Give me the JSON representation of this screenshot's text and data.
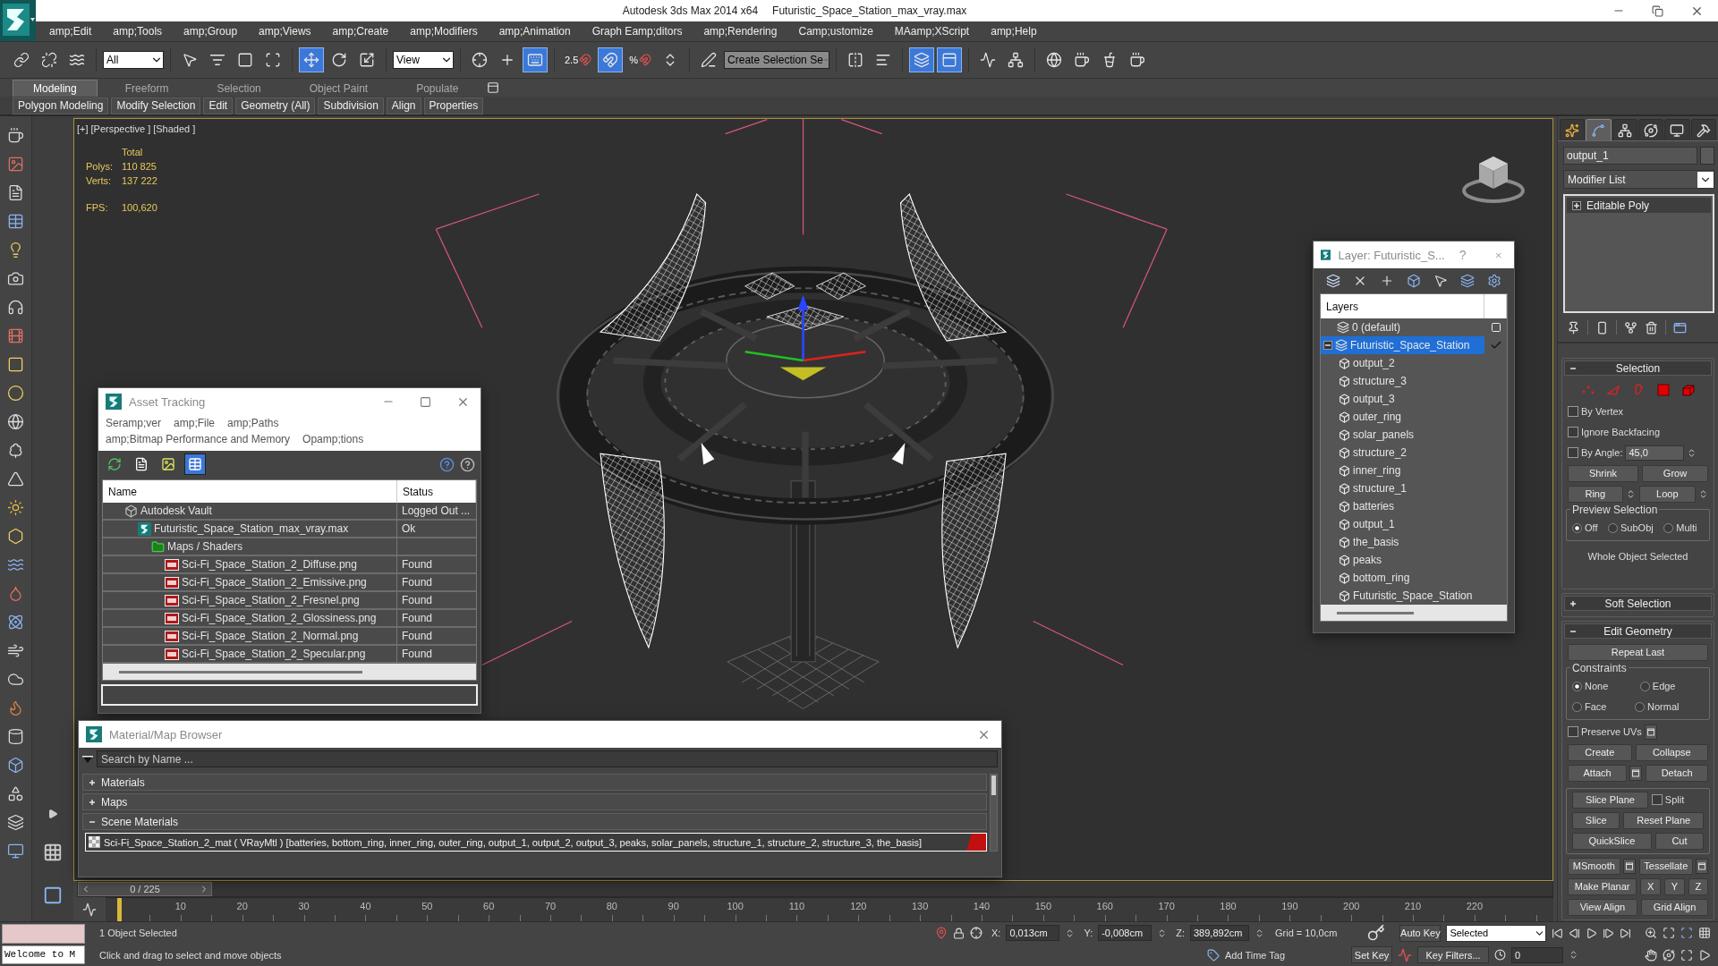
{
  "window": {
    "title": "Autodesk 3ds Max 2014 x64",
    "document": "Futuristic_Space_Station_max_vray.max"
  },
  "menu": [
    "amp;Edit",
    "amp;Tools",
    "amp;Group",
    "amp;Views",
    "amp;Create",
    "amp;Modifiers",
    "amp;Animation",
    "Graph Eamp;ditors",
    "amp;Rendering",
    "Camp;ustomize",
    "MAamp;XScript",
    "amp;Help"
  ],
  "main_toolbar": [
    {
      "kind": "button",
      "active": false
    },
    {
      "kind": "button",
      "active": false
    },
    {
      "kind": "button",
      "active": false
    },
    {
      "kind": "dropdown",
      "value": "All"
    },
    {
      "kind": "button",
      "active": false
    },
    {
      "kind": "button",
      "active": false
    },
    {
      "kind": "button",
      "active": false
    },
    {
      "kind": "button",
      "active": false
    },
    {
      "kind": "button",
      "active": true
    },
    {
      "kind": "button",
      "active": false
    },
    {
      "kind": "button",
      "active": false
    },
    {
      "kind": "dropdown",
      "value": "View"
    },
    {
      "kind": "button",
      "active": false
    },
    {
      "kind": "button",
      "active": false
    },
    {
      "kind": "button",
      "active": true
    },
    {
      "kind": "button",
      "active": false,
      "label": "2.5"
    },
    {
      "kind": "button",
      "active": true
    },
    {
      "kind": "button",
      "active": false,
      "label": "%"
    },
    {
      "kind": "button",
      "active": false
    },
    {
      "kind": "button",
      "active": false
    },
    {
      "kind": "field",
      "value": "Create Selection Se"
    },
    {
      "kind": "button",
      "active": false
    },
    {
      "kind": "button",
      "active": false
    },
    {
      "kind": "button",
      "active": true
    },
    {
      "kind": "button",
      "active": true
    },
    {
      "kind": "button",
      "active": false
    },
    {
      "kind": "button",
      "active": false
    },
    {
      "kind": "button",
      "active": false
    },
    {
      "kind": "button",
      "active": false
    },
    {
      "kind": "button",
      "active": false
    },
    {
      "kind": "button",
      "active": false
    }
  ],
  "ribbon": {
    "tabs": [
      {
        "label": "Modeling",
        "selected": true
      },
      {
        "label": "Freeform",
        "selected": false
      },
      {
        "label": "Selection",
        "selected": false
      },
      {
        "label": "Object Paint",
        "selected": false
      },
      {
        "label": "Populate",
        "selected": false
      }
    ],
    "panels": [
      "Polygon Modeling",
      "Modify Selection",
      "Edit",
      "Geometry (All)",
      "Subdivision",
      "Align",
      "Properties"
    ]
  },
  "viewport": {
    "labels": [
      "[+]",
      "[Perspective ]",
      "[Shaded ]"
    ],
    "stats": {
      "heading": "Total",
      "rows": [
        {
          "label": "Polys:",
          "value": "110 825"
        },
        {
          "label": "Verts:",
          "value": "137 222"
        }
      ],
      "fps": {
        "label": "FPS:",
        "value": "100,620"
      }
    }
  },
  "asset_tracking": {
    "title": "Asset Tracking",
    "menu_rows": [
      [
        "Seramp;ver",
        "amp;File",
        "amp;Paths"
      ],
      [
        "amp;Bitmap Performance and Memory",
        "Opamp;tions"
      ]
    ],
    "view_buttons": [
      {
        "selected": false
      },
      {
        "selected": false
      },
      {
        "selected": false
      },
      {
        "selected": true
      }
    ],
    "columns": [
      "Name",
      "Status"
    ],
    "rows": [
      {
        "kind": "vault",
        "name": "Autodesk Vault",
        "status": "Logged Out ...",
        "children": [
          {
            "kind": "scene",
            "name": "Futuristic_Space_Station_max_vray.max",
            "status": "Ok",
            "children": [
              {
                "kind": "folder",
                "name": "Maps / Shaders",
                "children": [
                  {
                    "kind": "image",
                    "name": "Sci-Fi_Space_Station_2_Diffuse.png",
                    "status": "Found"
                  },
                  {
                    "kind": "image",
                    "name": "Sci-Fi_Space_Station_2_Emissive.png",
                    "status": "Found"
                  },
                  {
                    "kind": "image",
                    "name": "Sci-Fi_Space_Station_2_Fresnel.png",
                    "status": "Found"
                  },
                  {
                    "kind": "image",
                    "name": "Sci-Fi_Space_Station_2_Glossiness.png",
                    "status": "Found"
                  },
                  {
                    "kind": "image",
                    "name": "Sci-Fi_Space_Station_2_Normal.png",
                    "status": "Found"
                  },
                  {
                    "kind": "image",
                    "name": "Sci-Fi_Space_Station_2_Specular.png",
                    "status": "Found"
                  }
                ]
              }
            ]
          }
        ]
      }
    ]
  },
  "layer_manager": {
    "title": "Layer: Futuristic_S...",
    "help": "?",
    "header": "Layers",
    "layers": [
      {
        "name": "0 (default)",
        "current": false,
        "selected": false
      },
      {
        "name": "Futuristic_Space_Station",
        "current": true,
        "selected": true,
        "expanded": true,
        "children": [
          {
            "name": "output_2",
            "selected": false
          },
          {
            "name": "structure_3",
            "selected": false
          },
          {
            "name": "output_3",
            "selected": false
          },
          {
            "name": "outer_ring",
            "selected": false
          },
          {
            "name": "solar_panels",
            "selected": false
          },
          {
            "name": "structure_2",
            "selected": false
          },
          {
            "name": "inner_ring",
            "selected": false
          },
          {
            "name": "structure_1",
            "selected": false
          },
          {
            "name": "batteries",
            "selected": false
          },
          {
            "name": "output_1",
            "selected": false
          },
          {
            "name": "the_basis",
            "selected": false
          },
          {
            "name": "peaks",
            "selected": false
          },
          {
            "name": "bottom_ring",
            "selected": false
          },
          {
            "name": "Futuristic_Space_Station",
            "selected": false
          }
        ]
      }
    ]
  },
  "material_browser": {
    "title": "Material/Map Browser",
    "search_placeholder": "Search by Name ...",
    "groups": [
      {
        "label": "Materials",
        "expanded": false
      },
      {
        "label": "Maps",
        "expanded": false
      },
      {
        "label": "Scene Materials",
        "expanded": true,
        "items": [
          {
            "text": "Sci-Fi_Space_Station_2_mat ( VRayMtl ) [batteries, bottom_ring, inner_ring, outer_ring, output_1, output_2, output_3, peaks, solar_panels, structure_1, structure_2, structure_3, the_basis]",
            "selected": true
          }
        ]
      }
    ]
  },
  "command_panel": {
    "tabs": [
      {
        "selected": false
      },
      {
        "selected": true
      },
      {
        "selected": false
      },
      {
        "selected": false
      },
      {
        "selected": false
      },
      {
        "selected": false
      }
    ],
    "object_name": "output_1",
    "modifier_list": "Modifier List",
    "stack": [
      {
        "label": "Editable Poly",
        "expanded": false
      }
    ],
    "rollouts": [
      {
        "title": "Selection",
        "expanded": true,
        "rows": [
          {
            "kind": "row",
            "items": [
              {
                "kind": "subobject",
                "selected": false
              },
              {
                "kind": "subobject",
                "selected": false
              },
              {
                "kind": "subobject",
                "selected": false
              },
              {
                "kind": "subobject",
                "selected": false
              },
              {
                "kind": "subobject",
                "selected": false
              }
            ]
          },
          {
            "kind": "row",
            "items": [
              {
                "kind": "checkbox",
                "label": "By Vertex",
                "checked": false
              }
            ]
          },
          {
            "kind": "row",
            "items": [
              {
                "kind": "checkbox",
                "label": "Ignore Backfacing",
                "checked": false
              }
            ]
          },
          {
            "kind": "row",
            "items": [
              {
                "kind": "checkbox",
                "label": "By Angle:",
                "checked": false,
                "value": "45,0"
              }
            ]
          },
          {
            "kind": "row",
            "items": [
              {
                "kind": "button",
                "label": "Shrink"
              },
              {
                "kind": "button",
                "label": "Grow"
              }
            ]
          },
          {
            "kind": "row",
            "items": [
              {
                "kind": "button",
                "label": "Ring",
                "spinner": true
              },
              {
                "kind": "button",
                "label": "Loop",
                "spinner": true
              }
            ]
          },
          {
            "kind": "group",
            "title": "Preview Selection",
            "rows": [
              {
                "kind": "row",
                "items": [
                  {
                    "kind": "radio",
                    "label": "Off",
                    "selected": true
                  },
                  {
                    "kind": "radio",
                    "label": "SubObj",
                    "selected": false
                  },
                  {
                    "kind": "radio",
                    "label": "Multi",
                    "selected": false
                  }
                ]
              }
            ]
          },
          {
            "kind": "row",
            "items": [
              {
                "kind": "note",
                "text": "Whole Object Selected"
              }
            ]
          }
        ]
      },
      {
        "title": "Soft Selection",
        "expanded": false
      },
      {
        "title": "Edit Geometry",
        "expanded": true,
        "rows": [
          {
            "kind": "row",
            "items": [
              {
                "kind": "button",
                "label": "Repeat Last"
              }
            ]
          },
          {
            "kind": "group",
            "title": "Constraints",
            "rows": [
              {
                "kind": "row",
                "items": [
                  {
                    "kind": "radio",
                    "label": "None",
                    "selected": true
                  },
                  {
                    "kind": "radio",
                    "label": "Edge",
                    "selected": false
                  }
                ]
              },
              {
                "kind": "row",
                "items": [
                  {
                    "kind": "radio",
                    "label": "Face",
                    "selected": false
                  },
                  {
                    "kind": "radio",
                    "label": "Normal",
                    "selected": false
                  }
                ]
              }
            ]
          },
          {
            "kind": "row",
            "items": [
              {
                "kind": "checkbox",
                "label": "Preserve UVs",
                "checked": false,
                "settings": true
              }
            ]
          },
          {
            "kind": "row",
            "items": [
              {
                "kind": "button",
                "label": "Create"
              },
              {
                "kind": "button",
                "label": "Collapse"
              }
            ]
          },
          {
            "kind": "row",
            "items": [
              {
                "kind": "button",
                "label": "Attach",
                "settings": true
              },
              {
                "kind": "button",
                "label": "Detach"
              }
            ]
          },
          {
            "kind": "group",
            "rows": [
              {
                "kind": "row",
                "items": [
                  {
                    "kind": "button",
                    "label": "Slice Plane"
                  },
                  {
                    "kind": "checkbox",
                    "label": "Split",
                    "checked": false
                  }
                ]
              },
              {
                "kind": "row",
                "items": [
                  {
                    "kind": "button",
                    "label": "Slice"
                  },
                  {
                    "kind": "button",
                    "label": "Reset Plane"
                  }
                ]
              },
              {
                "kind": "row",
                "items": [
                  {
                    "kind": "button",
                    "label": "QuickSlice"
                  },
                  {
                    "kind": "button",
                    "label": "Cut"
                  }
                ]
              }
            ]
          },
          {
            "kind": "row",
            "items": [
              {
                "kind": "button",
                "label": "MSmooth",
                "settings": true
              },
              {
                "kind": "button",
                "label": "Tessellate",
                "settings": true
              }
            ]
          },
          {
            "kind": "row",
            "items": [
              {
                "kind": "button",
                "label": "Make Planar"
              },
              {
                "kind": "button",
                "label": "X"
              },
              {
                "kind": "button",
                "label": "Y"
              },
              {
                "kind": "button",
                "label": "Z"
              }
            ]
          },
          {
            "kind": "row",
            "items": [
              {
                "kind": "button",
                "label": "View Align"
              },
              {
                "kind": "button",
                "label": "Grid Align"
              }
            ]
          }
        ]
      }
    ]
  },
  "time_slider": {
    "label": "0 / 225",
    "level": 0
  },
  "timeline": {
    "ticks": [
      "10",
      "20",
      "30",
      "40",
      "50",
      "60",
      "70",
      "80",
      "90",
      "100",
      "110",
      "120",
      "130",
      "140",
      "150",
      "160",
      "170",
      "180",
      "190",
      "200",
      "210",
      "220"
    ]
  },
  "status_bar": {
    "listener_output": "Welcome to M",
    "selection": "1 Object Selected",
    "prompt": "Click and drag to select and move objects",
    "coordinates": [
      {
        "label": "X:",
        "value": "0,013cm"
      },
      {
        "label": "Y:",
        "value": "-0,008cm"
      },
      {
        "label": "Z:",
        "value": "389,892cm"
      }
    ],
    "grid": "Grid = 10,0cm",
    "time_tag": "Add Time Tag",
    "auto_key": "Auto Key",
    "set_key": "Set Key",
    "key_mode": "Selected",
    "key_filters": "Key Filters...",
    "frame": "0"
  }
}
